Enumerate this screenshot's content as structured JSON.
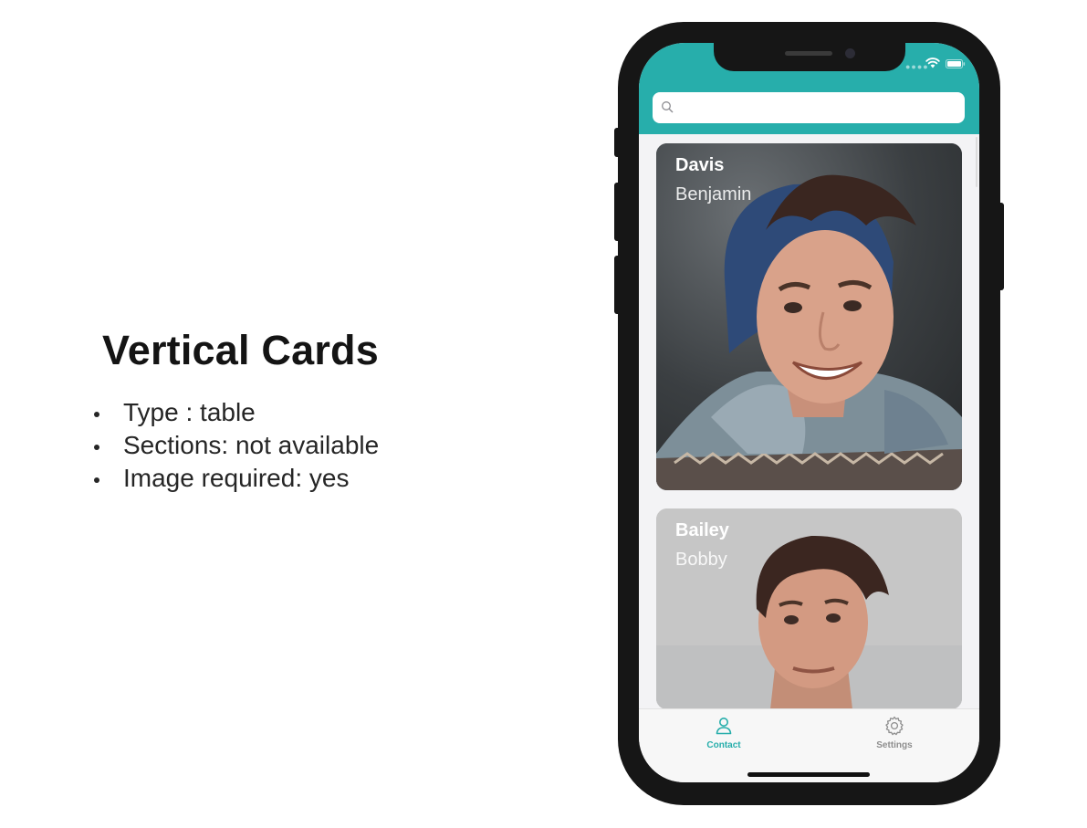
{
  "description": {
    "title": "Vertical Cards",
    "bullets": [
      "Type : table",
      "Sections: not available",
      "Image required: yes"
    ]
  },
  "app": {
    "colors": {
      "accent": "#27aeab",
      "tab_inactive": "#8e8e8e",
      "phone_frame": "#161616"
    },
    "search": {
      "value": "",
      "placeholder": "",
      "icon": "search-icon"
    },
    "cards": [
      {
        "last_name": "Davis",
        "first_name": "Benjamin"
      },
      {
        "last_name": "Bailey",
        "first_name": "Bobby"
      }
    ],
    "tabbar": {
      "tabs": [
        {
          "label": "Contact",
          "icon": "person-icon",
          "active": true
        },
        {
          "label": "Settings",
          "icon": "gear-icon",
          "active": false
        }
      ]
    }
  }
}
